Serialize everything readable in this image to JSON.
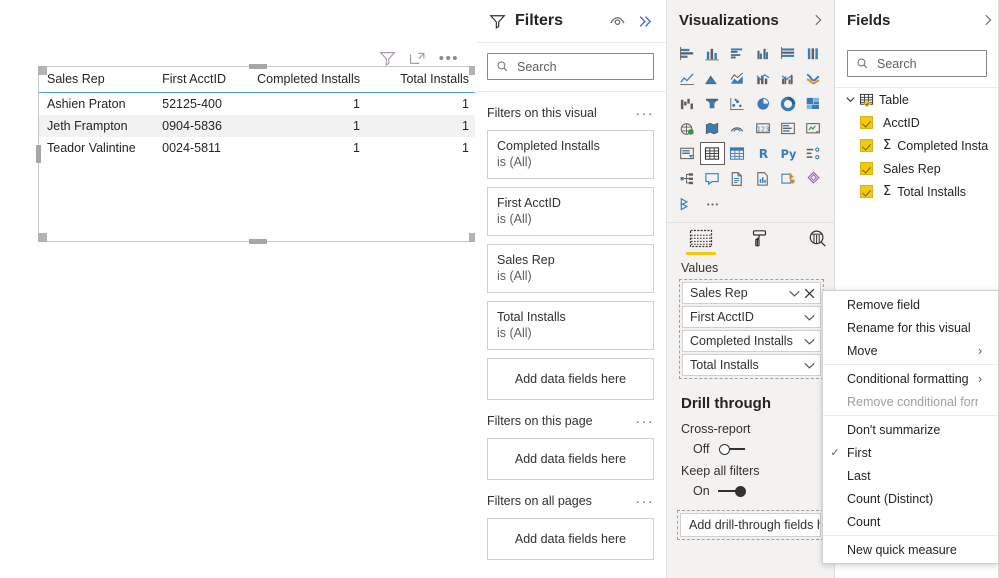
{
  "canvas": {
    "toolbar": {
      "filter_icon": "filter-icon",
      "focus_icon": "focus-mode-icon",
      "more_label": "•••"
    },
    "table_visual": {
      "columns": [
        {
          "label": "Sales Rep",
          "align": "left"
        },
        {
          "label": "First AcctID",
          "align": "left"
        },
        {
          "label": "Completed Installs",
          "align": "right"
        },
        {
          "label": "Total Installs",
          "align": "right"
        }
      ],
      "rows": [
        [
          "Ashien Praton",
          "52125-400",
          "1",
          "1"
        ],
        [
          "Jeth Frampton",
          "0904-5836",
          "1",
          "1"
        ],
        [
          "Teador Valintine",
          "0024-5811",
          "1",
          "1"
        ]
      ]
    }
  },
  "filters": {
    "title": "Filters",
    "eye_icon": "eye-icon",
    "expand_icon": "double-chevron-right-icon",
    "search": {
      "placeholder": "Search",
      "value": "",
      "icon": "search-icon"
    },
    "sections": [
      {
        "heading": "Filters on this visual",
        "more_label": "···",
        "cards": [
          {
            "name": "Completed Installs",
            "value": "is (All)"
          },
          {
            "name": "First AcctID",
            "value": "is (All)"
          },
          {
            "name": "Sales Rep",
            "value": "is (All)"
          },
          {
            "name": "Total Installs",
            "value": "is (All)"
          }
        ],
        "dropzone": "Add data fields here"
      },
      {
        "heading": "Filters on this page",
        "more_label": "···",
        "cards": [],
        "dropzone": "Add data fields here"
      },
      {
        "heading": "Filters on all pages",
        "more_label": "···",
        "cards": [],
        "dropzone": "Add data fields here"
      }
    ]
  },
  "visualizations": {
    "title": "Visualizations",
    "collapse_icon": "chevron-right-icon",
    "gallery": [
      "stacked-bar-chart-icon",
      "stacked-column-chart-icon",
      "clustered-bar-chart-icon",
      "clustered-column-chart-icon",
      "100-stacked-bar-chart-icon",
      "100-stacked-column-chart-icon",
      "line-chart-icon",
      "area-chart-icon",
      "stacked-area-chart-icon",
      "line-stacked-column-chart-icon",
      "line-clustered-column-chart-icon",
      "ribbon-chart-icon",
      "waterfall-chart-icon",
      "funnel-chart-icon",
      "scatter-chart-icon",
      "pie-chart-icon",
      "donut-chart-icon",
      "treemap-icon",
      "map-icon",
      "filled-map-icon",
      "arcgis-map-icon",
      "card-icon",
      "multi-row-card-icon",
      "kpi-icon",
      "slicer-icon",
      "table-icon",
      "matrix-icon",
      "r-script-visual-icon",
      "python-visual-icon",
      "key-influencers-icon",
      "decomposition-tree-icon",
      "qa-visual-icon",
      "paginated-report-icon",
      "smart-narrative-icon",
      "powerapps-icon",
      "power-automate-icon",
      "get-more-visuals-icon",
      "more-options-icon"
    ],
    "gallery_selected_index": 25,
    "tabs": [
      {
        "label": "fields-tab",
        "icon": "fields-grid-icon",
        "active": true
      },
      {
        "label": "format-tab",
        "icon": "paint-roller-icon",
        "active": false
      },
      {
        "label": "analytics-tab",
        "icon": "magnifier-chart-icon",
        "active": false
      }
    ],
    "values_well": {
      "label": "Values",
      "fields": [
        {
          "name": "Sales Rep",
          "active": true,
          "has_remove": true
        },
        {
          "name": "First AcctID",
          "active": false,
          "has_remove": false
        },
        {
          "name": "Completed Installs",
          "active": false,
          "has_remove": false
        },
        {
          "name": "Total Installs",
          "active": false,
          "has_remove": false
        }
      ]
    },
    "drill_through": {
      "title": "Drill through",
      "cross_report": {
        "label": "Cross-report",
        "state": "Off",
        "on": false
      },
      "keep_all_filters": {
        "label": "Keep all filters",
        "state": "On",
        "on": true
      },
      "dropzone": "Add drill-through fields here"
    }
  },
  "fields": {
    "title": "Fields",
    "collapse_icon": "chevron-right-icon",
    "search": {
      "placeholder": "Search",
      "value": "",
      "icon": "search-icon"
    },
    "tree": {
      "table_name": "Table",
      "expand_icon": "chevron-down-icon",
      "table_icon": "table-key-icon",
      "items": [
        {
          "label": "AcctID",
          "checked": true,
          "measure": false
        },
        {
          "label": "Completed Insta",
          "checked": true,
          "measure": true
        },
        {
          "label": "Sales Rep",
          "checked": true,
          "measure": false
        },
        {
          "label": "Total Installs",
          "checked": true,
          "measure": true
        }
      ]
    }
  },
  "context_menu": {
    "items": [
      {
        "label": "Remove field",
        "checked": false,
        "submenu": false,
        "disabled": false,
        "sep_after": false
      },
      {
        "label": "Rename for this visual",
        "checked": false,
        "submenu": false,
        "disabled": false,
        "sep_after": false
      },
      {
        "label": "Move",
        "checked": false,
        "submenu": true,
        "disabled": false,
        "sep_after": true
      },
      {
        "label": "Conditional formatting",
        "checked": false,
        "submenu": true,
        "disabled": false,
        "sep_after": false
      },
      {
        "label": "Remove conditional formatting",
        "checked": false,
        "submenu": false,
        "disabled": true,
        "sep_after": true
      },
      {
        "label": "Don't summarize",
        "checked": false,
        "submenu": false,
        "disabled": false,
        "sep_after": false
      },
      {
        "label": "First",
        "checked": true,
        "submenu": false,
        "disabled": false,
        "sep_after": false
      },
      {
        "label": "Last",
        "checked": false,
        "submenu": false,
        "disabled": false,
        "sep_after": false
      },
      {
        "label": "Count (Distinct)",
        "checked": false,
        "submenu": false,
        "disabled": false,
        "sep_after": false
      },
      {
        "label": "Count",
        "checked": false,
        "submenu": false,
        "disabled": false,
        "sep_after": true
      },
      {
        "label": "New quick measure",
        "checked": false,
        "submenu": false,
        "disabled": false,
        "sep_after": false
      }
    ],
    "check_glyph": "✓",
    "submenu_glyph": "›"
  },
  "colors": {
    "accent_yellow": "#F2C811",
    "header_underline": "#4A9FD8",
    "pane_bg": "#F3F2F1",
    "alt_row": "#F3F2F1",
    "text": "#252423"
  }
}
